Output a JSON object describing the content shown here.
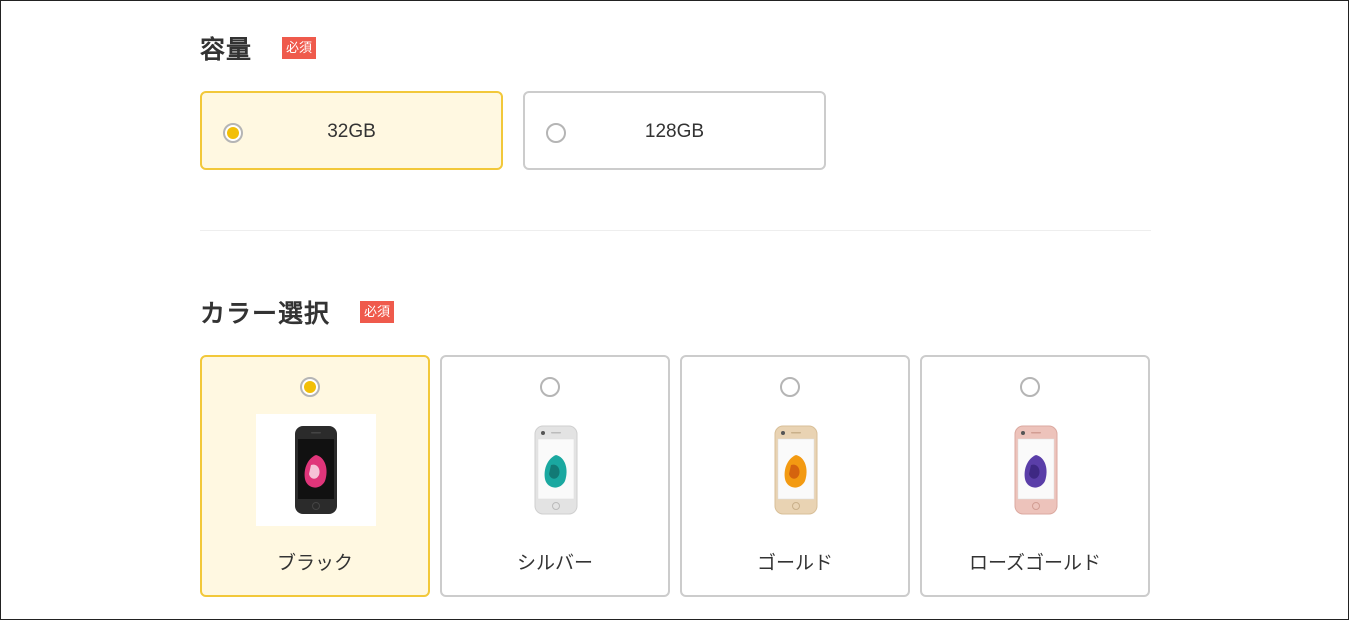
{
  "capacity": {
    "title": "容量",
    "required_badge": "必須",
    "options": [
      {
        "label": "32GB",
        "selected": true
      },
      {
        "label": "128GB",
        "selected": false
      }
    ]
  },
  "color": {
    "title": "カラー選択",
    "required_badge": "必須",
    "options": [
      {
        "label": "ブラック",
        "selected": true,
        "body": "#2b2b2b",
        "bezel": "#1a1a1a",
        "screen": "#111111",
        "accent": "#e0357a"
      },
      {
        "label": "シルバー",
        "selected": false,
        "body": "#e3e3e3",
        "bezel": "#ffffff",
        "screen": "#fafafa",
        "accent": "#1aa8a0"
      },
      {
        "label": "ゴールド",
        "selected": false,
        "body": "#e9d3b3",
        "bezel": "#ffffff",
        "screen": "#fafafa",
        "accent": "#f39a12"
      },
      {
        "label": "ローズゴールド",
        "selected": false,
        "body": "#edc3bb",
        "bezel": "#ffffff",
        "screen": "#fafafa",
        "accent": "#5a3ea8"
      }
    ]
  },
  "colors": {
    "accent": "#f2c83a",
    "selected_bg": "#fff8e1",
    "badge": "#ef5a4c"
  }
}
